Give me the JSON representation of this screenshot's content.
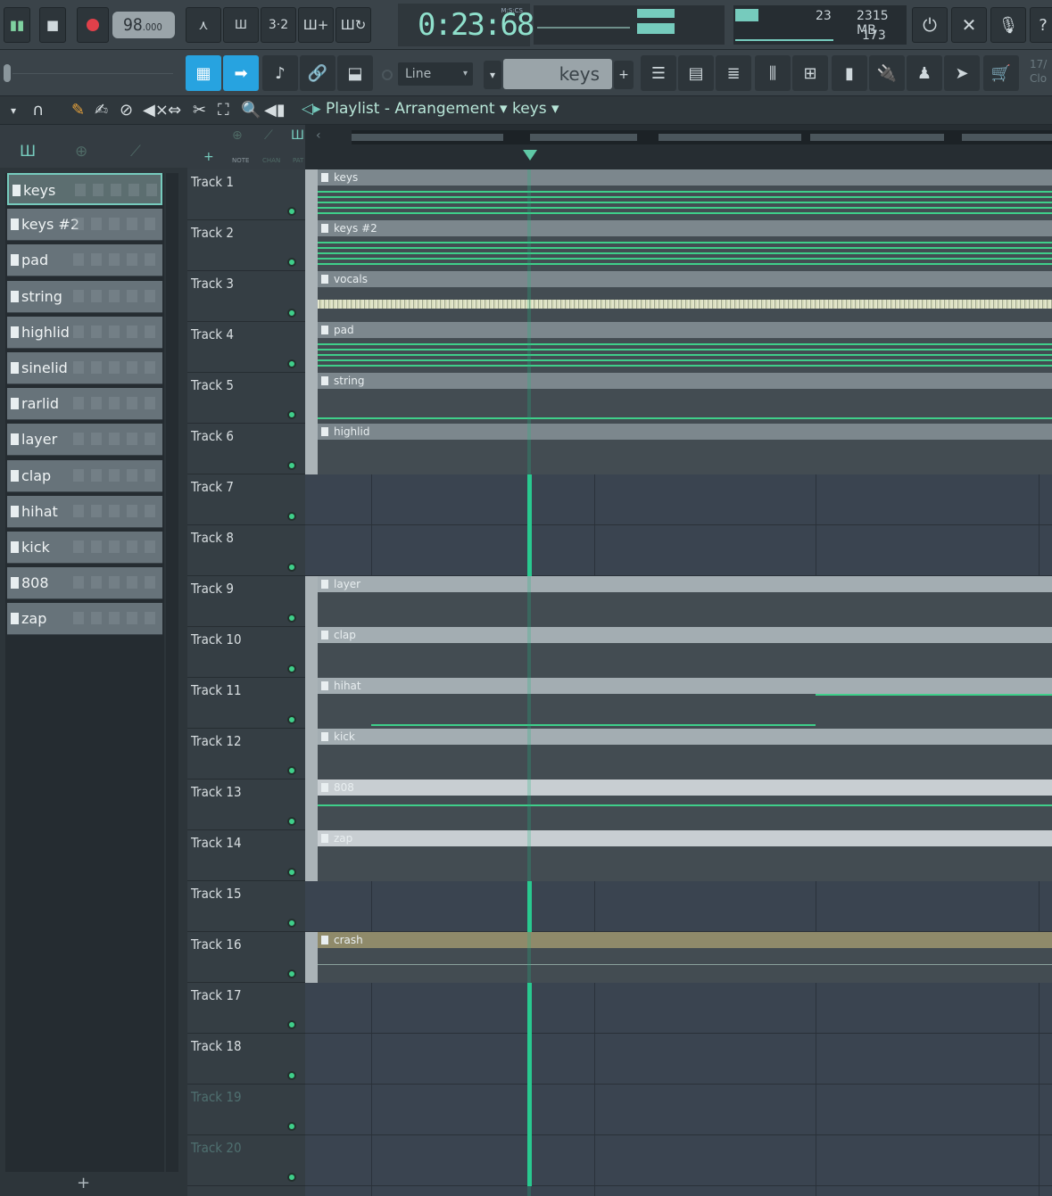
{
  "transport": {
    "tempo_main": "98",
    "tempo_dec": ".000",
    "time": "0:23",
    "time_frac": "68",
    "time_unit": "M:S:CS"
  },
  "cpu": {
    "value1": "23",
    "memory": "2315 MB",
    "voices": "173"
  },
  "toolbar2": {
    "snap_label": "Line",
    "pattern": "keys",
    "cloud_label": "17/\nClo"
  },
  "playlist": {
    "title": "Playlist",
    "breadcrumb_sep": "-",
    "section": "Arrangement",
    "pattern": "keys"
  },
  "header_labels": {
    "note": "NOTE",
    "chan": "CHAN",
    "pat": "PAT"
  },
  "patterns": [
    {
      "label": "keys"
    },
    {
      "label": "keys #2"
    },
    {
      "label": "pad"
    },
    {
      "label": "string"
    },
    {
      "label": "highlid"
    },
    {
      "label": "sinelid"
    },
    {
      "label": "rarlid"
    },
    {
      "label": "layer"
    },
    {
      "label": "clap"
    },
    {
      "label": "hihat"
    },
    {
      "label": "kick"
    },
    {
      "label": "808"
    },
    {
      "label": "zap"
    }
  ],
  "tracks": [
    {
      "name": "Track 1"
    },
    {
      "name": "Track 2"
    },
    {
      "name": "Track 3"
    },
    {
      "name": "Track 4"
    },
    {
      "name": "Track 5"
    },
    {
      "name": "Track 6"
    },
    {
      "name": "Track 7"
    },
    {
      "name": "Track 8"
    },
    {
      "name": "Track 9"
    },
    {
      "name": "Track 10"
    },
    {
      "name": "Track 11"
    },
    {
      "name": "Track 12"
    },
    {
      "name": "Track 13"
    },
    {
      "name": "Track 14"
    },
    {
      "name": "Track 15"
    },
    {
      "name": "Track 16"
    },
    {
      "name": "Track 17"
    },
    {
      "name": "Track 18"
    },
    {
      "name": "Track 19"
    },
    {
      "name": "Track 20"
    }
  ],
  "clips": [
    {
      "track": 1,
      "label": "keys"
    },
    {
      "track": 2,
      "label": "keys #2"
    },
    {
      "track": 3,
      "label": "vocals"
    },
    {
      "track": 4,
      "label": "pad"
    },
    {
      "track": 5,
      "label": "string"
    },
    {
      "track": 6,
      "label": "highlid"
    },
    {
      "track": 9,
      "label": "layer"
    },
    {
      "track": 10,
      "label": "clap"
    },
    {
      "track": 11,
      "label": "hihat"
    },
    {
      "track": 12,
      "label": "kick"
    },
    {
      "track": 13,
      "label": "808"
    },
    {
      "track": 14,
      "label": "zap"
    },
    {
      "track": 16,
      "label": "crash"
    }
  ],
  "colors": {
    "accent": "#76cbbd",
    "active_button": "#27a3e0",
    "led": "#3fcf8a",
    "playhead": "#28c98f"
  }
}
